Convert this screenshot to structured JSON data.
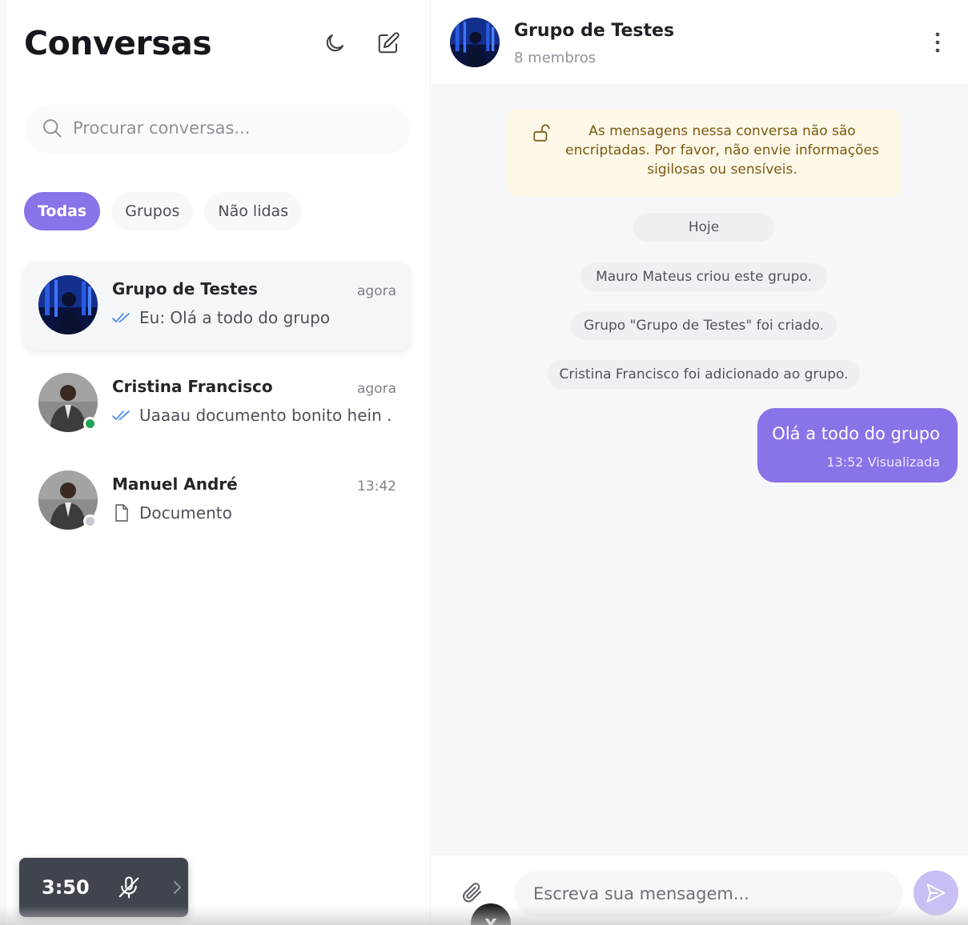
{
  "sidebar": {
    "title": "Conversas",
    "icons": {
      "theme": "moon-icon",
      "compose": "edit-icon"
    },
    "search": {
      "placeholder": "Procurar conversas...",
      "value": ""
    },
    "filters": [
      {
        "label": "Todas",
        "active": true
      },
      {
        "label": "Grupos",
        "active": false
      },
      {
        "label": "Não lidas",
        "active": false
      }
    ],
    "conversations": [
      {
        "name": "Grupo de Testes",
        "time": "agora",
        "preview": "Eu: Olá a todo do grupo",
        "preview_icon": "double-check-icon",
        "selected": true
      },
      {
        "name": "Cristina Francisco",
        "time": "agora",
        "preview": "Uaaau documento bonito hein ...",
        "preview_icon": "double-check-icon",
        "presence": "online"
      },
      {
        "name": "Manuel André",
        "time": "13:42",
        "preview": "Documento",
        "preview_icon": "document-icon",
        "presence": "offline"
      }
    ]
  },
  "call_widget": {
    "time": "3:50",
    "icon": "mic-off-icon"
  },
  "chat": {
    "header": {
      "name": "Grupo de Testes",
      "subtitle": "8 membros"
    },
    "notice": "As mensagens nessa conversa não são encriptadas. Por favor, não envie informações sigilosas ou sensíveis.",
    "system_messages": [
      "Hoje",
      "Mauro Mateus criou este grupo.",
      "Grupo \"Grupo de Testes\" foi criado.",
      "Cristina Francisco foi adicionado ao grupo."
    ],
    "messages": [
      {
        "text": "Olá a todo do grupo",
        "time": "13:52",
        "status": "Visualizada"
      }
    ],
    "composer": {
      "placeholder": "Escreva sua mensagem..."
    },
    "floating_badge": "X"
  },
  "colors": {
    "accent": "#8a72e8",
    "online": "#22a35a",
    "notice_bg": "#fdf8e8",
    "notice_text": "#7a5a12"
  }
}
